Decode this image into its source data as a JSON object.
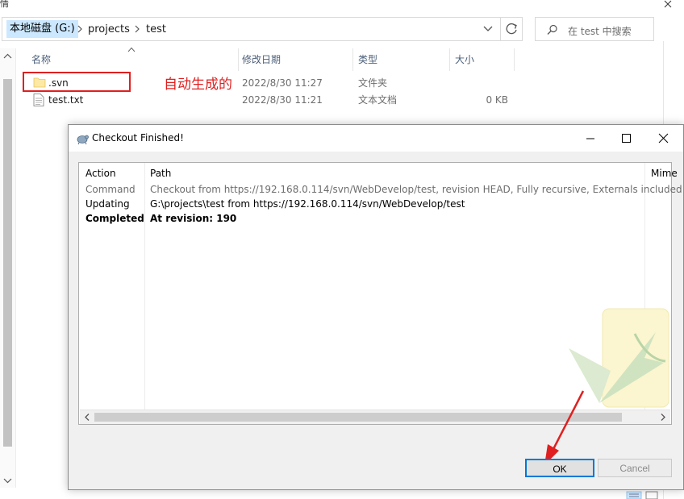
{
  "explorer": {
    "title_fragment": "情",
    "address": {
      "root": "本地磁盘 (G:)",
      "crumbs": [
        "projects",
        "test"
      ]
    },
    "search_placeholder": "在 test 中搜索",
    "columns": {
      "name": "名称",
      "modified": "修改日期",
      "type": "类型",
      "size": "大小"
    },
    "files": [
      {
        "name": ".svn",
        "modified": "2022/8/30 11:27",
        "type": "文件夹",
        "size": ""
      },
      {
        "name": "test.txt",
        "modified": "2022/8/30 11:21",
        "type": "文本文档",
        "size": "0 KB"
      }
    ],
    "annotation": "自动生成的",
    "annotation_color": "#e02020"
  },
  "dialog": {
    "title": "Checkout Finished!",
    "columns": {
      "action": "Action",
      "path": "Path",
      "mime": "Mime"
    },
    "rows": [
      {
        "action": "Command",
        "path": "Checkout from https://192.168.0.114/svn/WebDevelop/test, revision HEAD, Fully recursive, Externals included",
        "style": "gray"
      },
      {
        "action": "Updating",
        "path": "G:\\projects\\test from https://192.168.0.114/svn/WebDevelop/test",
        "style": "black"
      },
      {
        "action": "Completed",
        "path": "At revision: 190",
        "style": "bold"
      }
    ],
    "buttons": {
      "ok": "OK",
      "cancel": "Cancel"
    },
    "accent_color": "#0078d7"
  }
}
